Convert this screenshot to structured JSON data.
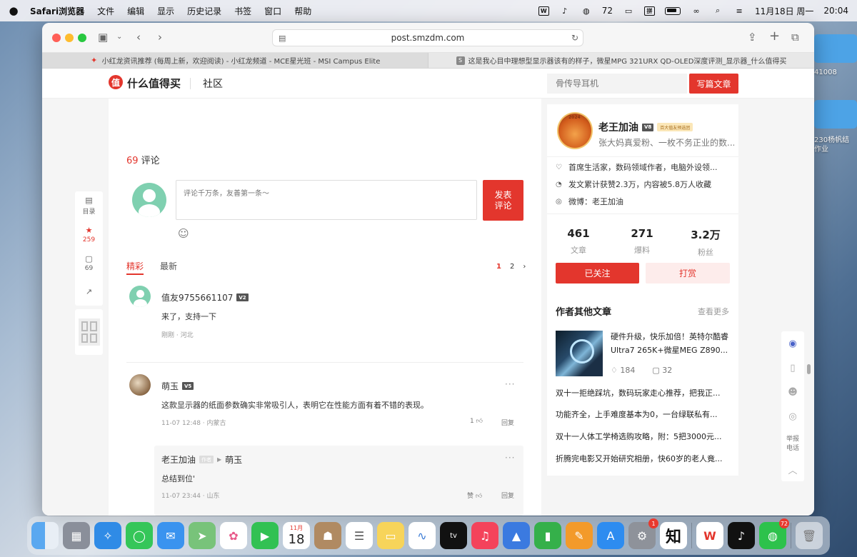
{
  "menubar": {
    "app": "Safari浏览器",
    "items": [
      "文件",
      "编辑",
      "显示",
      "历史记录",
      "书签",
      "窗口",
      "帮助"
    ],
    "wechat_count": "72",
    "ime": "拼",
    "date": "11月18日 周一",
    "time": "20:04"
  },
  "desktop": {
    "label1": "41008",
    "label2": "230杨帆结",
    "label3": "作业"
  },
  "browser": {
    "url": "post.smzdm.com",
    "tabs": [
      {
        "title": "小红龙资讯推荐 (每周上新，欢迎阅读) - 小红龙频道 - MCE星光班 - MSI Campus Elite"
      },
      {
        "title": "这是我心目中理想型显示器该有的样子，微星MPG 321URX QD-OLED深度评测_显示器_什么值得买",
        "favicon": "S"
      }
    ]
  },
  "site": {
    "logo_char": "值",
    "logo_text": "什么值得买",
    "nav_community": "社区",
    "search_placeholder": "骨传导耳机",
    "write_button": "写篇文章"
  },
  "side_float": {
    "toc_label": "目录",
    "star_count": "259",
    "comment_count": "69"
  },
  "comments": {
    "count": "69",
    "title_suffix": " 评论",
    "input_placeholder": "评论千万条，友善第一条～",
    "submit_line1": "发表",
    "submit_line2": "评论",
    "tabs": [
      "精彩",
      "最新"
    ],
    "pages": [
      "1",
      "2"
    ],
    "list": [
      {
        "name": "值友9755661107",
        "level": "V2",
        "text": "来了，支持一下",
        "meta": "刚刚 · 河北"
      },
      {
        "name": "萌玉",
        "level": "V5",
        "text": "这款显示器的纸面参数确实非常吸引人，表明它在性能方面有着不错的表现。",
        "meta": "11-07 12:48 · 内蒙古",
        "likes": "1",
        "reply": "回复"
      }
    ],
    "reply": {
      "name": "老王加油",
      "tag": "作者",
      "to": "萌玉",
      "text": "总结到位'",
      "meta": "11-07 23:44 · 山东",
      "like_label": "赞",
      "reply": "回复"
    }
  },
  "author": {
    "name": "老王加油",
    "level": "V8",
    "badge": "百大值友预选团",
    "bio": "张大妈真爱粉、一枚不务正业的数...",
    "info": [
      "首席生活家，数码领域作者，电脑外设领...",
      "发文累计获赞2.3万，内容被5.8万人收藏",
      "微博：老王加油"
    ],
    "stats": [
      {
        "value": "461",
        "label": "文章"
      },
      {
        "value": "271",
        "label": "爆料"
      },
      {
        "value": "3.2万",
        "label": "粉丝"
      }
    ],
    "follow_button": "已关注",
    "tip_button": "打赏",
    "other_title": "作者其他文章",
    "other_more": "查看更多",
    "featured": {
      "title": "硬件升级，快乐加倍！英特尔酷睿Ultra7 265K+微星MEG Z890...",
      "likes": "184",
      "comments": "32"
    },
    "articles": [
      "双十一拒绝踩坑，数码玩家走心推荐，把我正...",
      "功能齐全，上手难度基本为0，一台绿联私有...",
      "双十一人体工学椅选购攻略，附：5把3000元...",
      "折腾完电影又开始研究相册，快60岁的老人竟..."
    ]
  },
  "right_tools": {
    "report_line1": "举报",
    "report_line2": "电话"
  },
  "dock": {
    "calendar_month": "11月",
    "calendar_day": "18",
    "settings_badge": "1",
    "wechat_badge": "72",
    "zhihu": "知",
    "apps": [
      "Finder",
      "Launchpad",
      "Safari",
      "Messages",
      "Mail",
      "Maps",
      "Photos",
      "FaceTime",
      "Calendar",
      "Contacts",
      "Reminders",
      "Notes",
      "Freeform",
      "TV",
      "Music",
      "Keynote",
      "Numbers",
      "Pages",
      "App Store",
      "System Settings",
      "Zhihu",
      "WPS",
      "TikTok",
      "WeChat",
      "Trash"
    ],
    "colors": {
      "accent": "#e3362d"
    }
  }
}
